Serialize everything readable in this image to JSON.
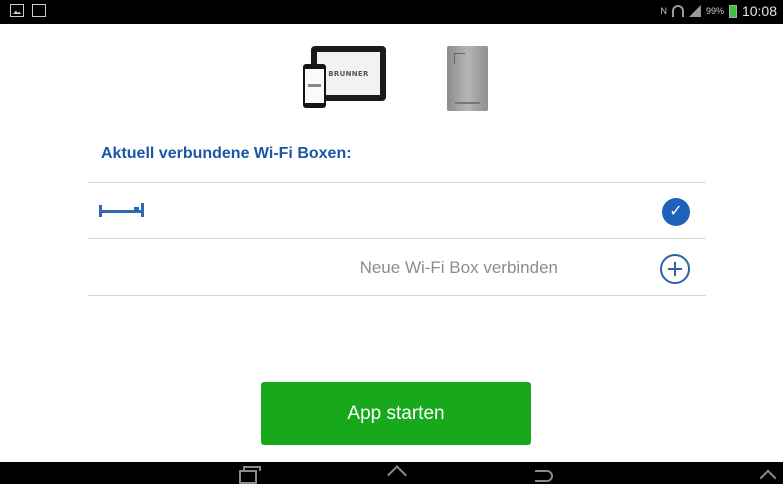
{
  "status_bar": {
    "left_icons": [
      "gallery-icon",
      "sim-card-icon"
    ],
    "right_icons": [
      "nfc-icon",
      "wifi-icon",
      "signal-icon",
      "battery-icon"
    ],
    "battery_percent": "99%",
    "time": "10:08"
  },
  "header": {
    "brand_text": "BRUNNER"
  },
  "section": {
    "title": "Aktuell verbundene Wi-Fi Boxen:"
  },
  "connected_box": {
    "icon": "router-icon",
    "status_icon": "check-icon",
    "checked": true
  },
  "add_box": {
    "label": "Neue Wi-Fi Box verbinden",
    "icon": "plus-circle-icon"
  },
  "start_button": {
    "label": "App starten",
    "color": "#18a81b"
  },
  "nav_bar": {
    "buttons": [
      "recent-apps-icon",
      "home-icon",
      "back-icon",
      "up-icon"
    ]
  },
  "colors": {
    "accent_blue": "#1c57a6",
    "button_green": "#18a81b",
    "text_gray": "#8c8c8c"
  }
}
